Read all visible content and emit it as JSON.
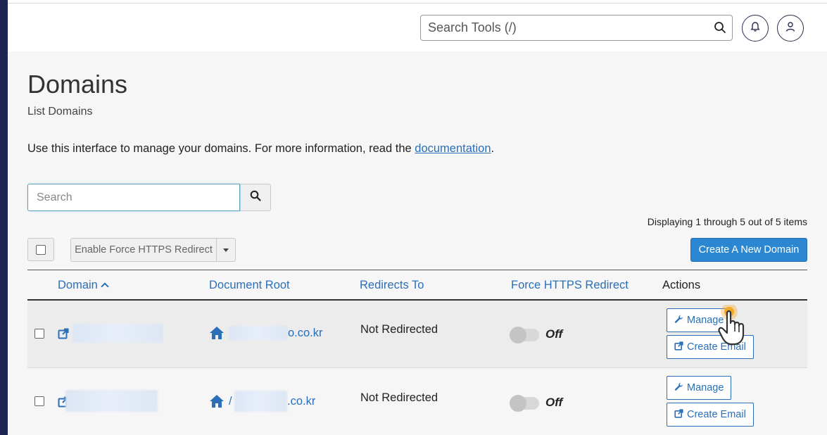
{
  "header": {
    "search_placeholder": "Search Tools (/)",
    "icons": [
      "search-icon",
      "bell-icon",
      "user-icon"
    ]
  },
  "page": {
    "title": "Domains",
    "subtitle": "List Domains",
    "description_prefix": "Use this interface to manage your domains. For more information, read the ",
    "description_link": "documentation",
    "description_suffix": "."
  },
  "toolbar": {
    "search_placeholder": "Search",
    "displaying": "Displaying 1 through 5 out of 5 items",
    "enable_https_label": "Enable Force HTTPS Redirect",
    "create_domain_label": "Create A New Domain"
  },
  "table": {
    "columns": {
      "domain": "Domain",
      "document_root": "Document Root",
      "redirects_to": "Redirects To",
      "force_https": "Force HTTPS Redirect",
      "actions": "Actions"
    },
    "rows": [
      {
        "docroot_visible": "o.co.kr",
        "redirects_to": "Not Redirected",
        "https_state": "Off",
        "manage_label": "Manage",
        "create_email_label": "Create Email"
      },
      {
        "docroot_visible": "/",
        "docroot_suffix": ".co.kr",
        "redirects_to": "Not Redirected",
        "https_state": "Off",
        "manage_label": "Manage",
        "create_email_label": "Create Email"
      }
    ]
  },
  "colors": {
    "accent": "#2b87d1",
    "link": "#2a6fb8",
    "sidebar": "#1e2451",
    "background": "#f6f6f6"
  }
}
